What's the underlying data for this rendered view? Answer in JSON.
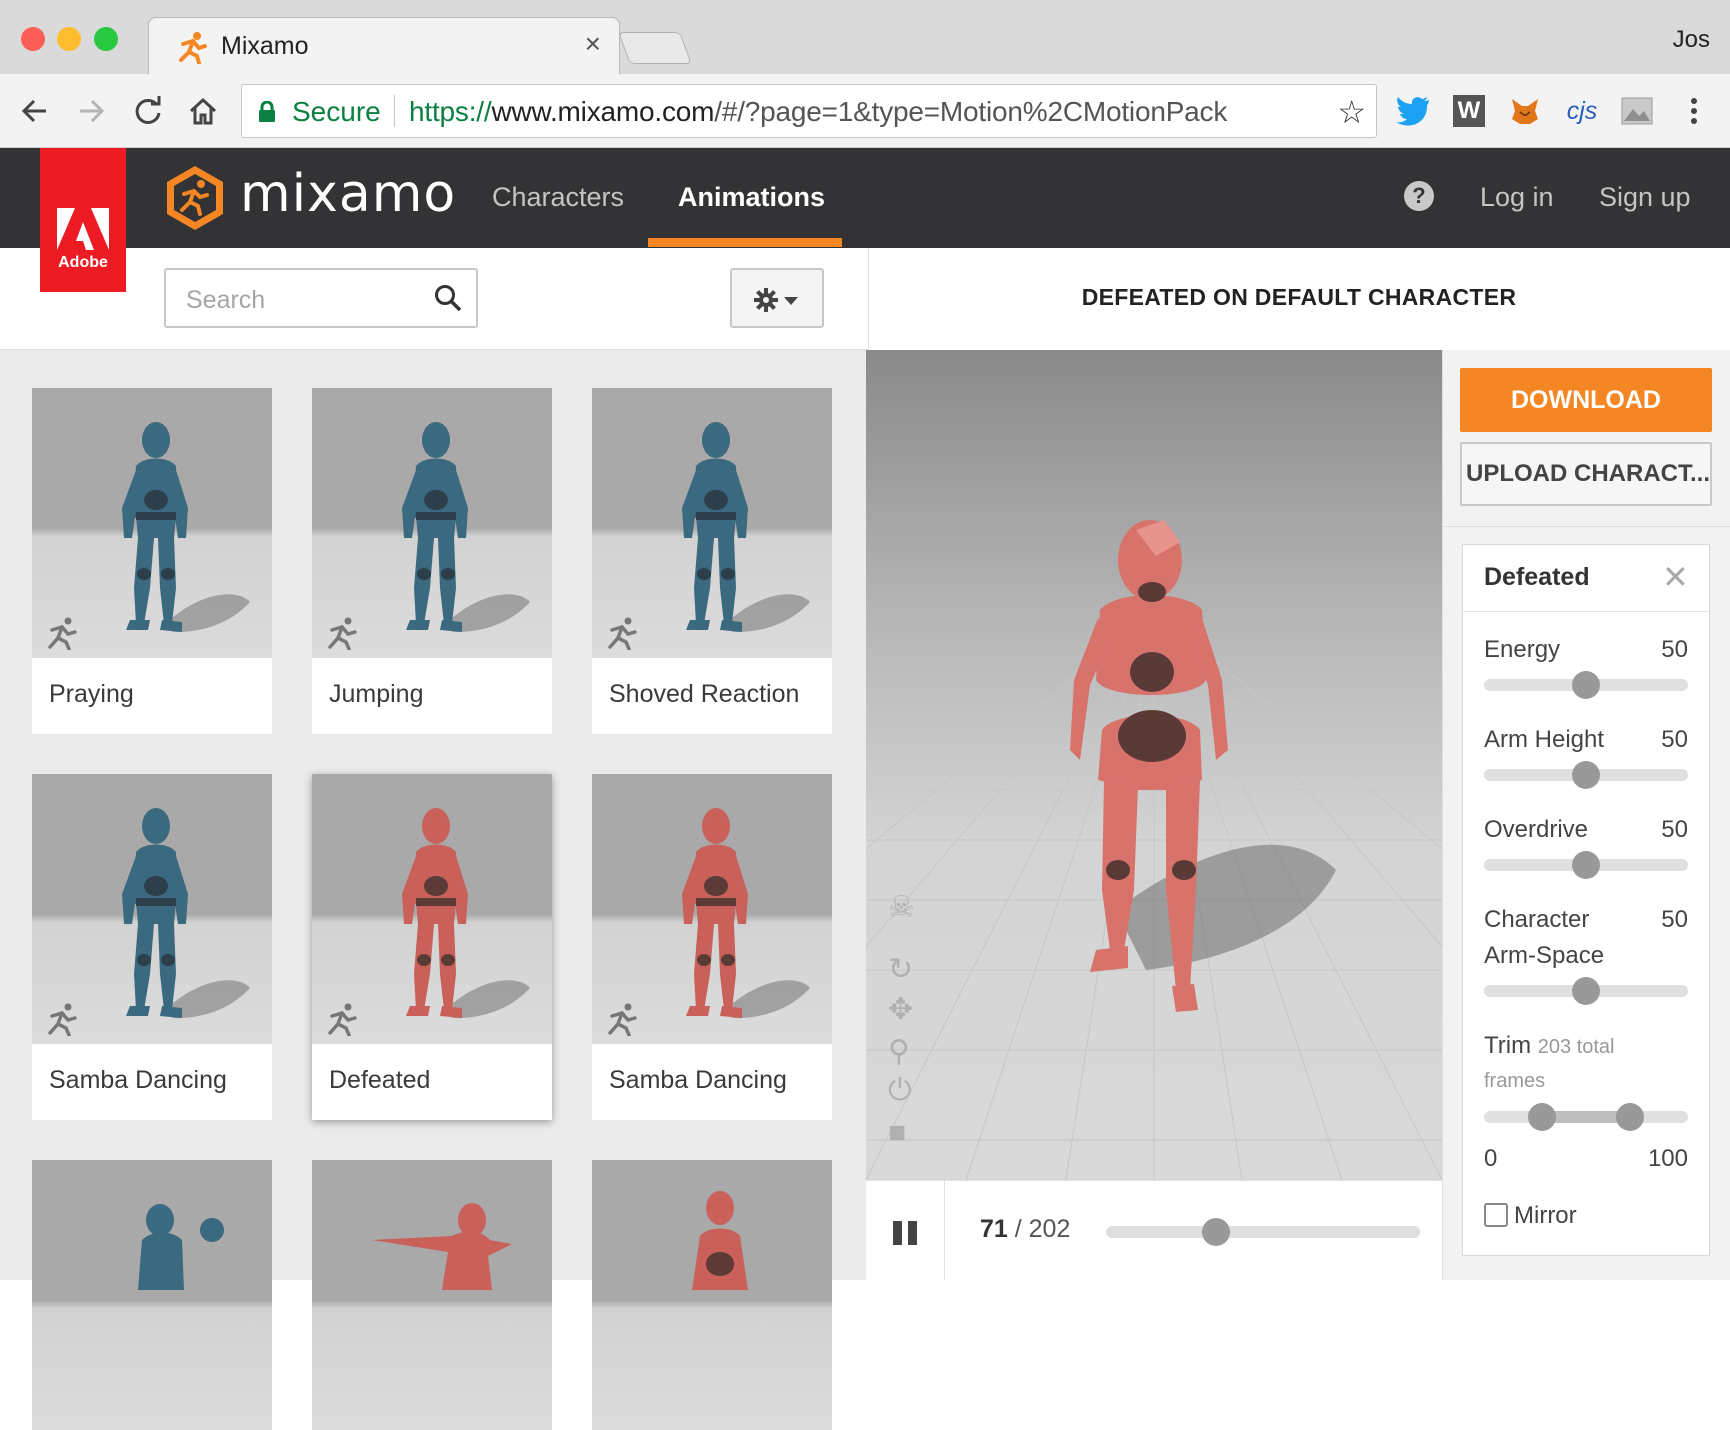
{
  "browser": {
    "tab_title": "Mixamo",
    "tab_close": "×",
    "profile_name": "Jos",
    "secure_label": "Secure",
    "url_scheme": "https://",
    "url_host": "www.mixamo.com",
    "url_path": "/#/?page=1&type=Motion%2CMotionPack",
    "extensions": [
      "twitter-icon",
      "w-icon",
      "metamask-fox-icon",
      "cjs-icon",
      "image-icon",
      "menu-dots-icon"
    ],
    "ext_cjs_label": "cjs",
    "ext_w_label": "W"
  },
  "header": {
    "adobe_label": "Adobe",
    "logo_text": "mixamo",
    "nav": {
      "characters": "Characters",
      "animations": "Animations"
    },
    "help_glyph": "?",
    "login": "Log in",
    "signup": "Sign up",
    "accent": "#f48623"
  },
  "search": {
    "placeholder": "Search"
  },
  "grid": {
    "cards": [
      {
        "label": "Praying",
        "figure": "blue"
      },
      {
        "label": "Jumping",
        "figure": "blue"
      },
      {
        "label": "Shoved Reaction",
        "figure": "blue"
      },
      {
        "label": "Samba Dancing",
        "figure": "blue"
      },
      {
        "label": "Defeated",
        "figure": "red",
        "selected": true
      },
      {
        "label": "Samba Dancing",
        "figure": "red"
      }
    ]
  },
  "viewer": {
    "title": "DEFEATED ON DEFAULT CHARACTER",
    "current_frame": "71",
    "frame_sep": " / ",
    "total_frames": "202",
    "scrub_fraction": 0.35,
    "tools": [
      "skull-icon",
      "rotate-icon",
      "move-icon",
      "zoom-icon",
      "reset-icon",
      "camera-icon"
    ]
  },
  "actions": {
    "download": "DOWNLOAD",
    "upload": "UPLOAD CHARACT..."
  },
  "settings": {
    "title": "Defeated",
    "close": "✕",
    "params": [
      {
        "label": "Energy",
        "value": "50"
      },
      {
        "label": "Arm Height",
        "value": "50"
      },
      {
        "label": "Overdrive",
        "value": "50"
      },
      {
        "label_line1": "Character",
        "label_line2": "Arm-Space",
        "value": "50"
      }
    ],
    "trim_label": "Trim",
    "trim_note_1": "203 total",
    "trim_note_2": "frames",
    "trim_min": "0",
    "trim_max": "100",
    "mirror_label": "Mirror",
    "mirror_checked": false
  }
}
